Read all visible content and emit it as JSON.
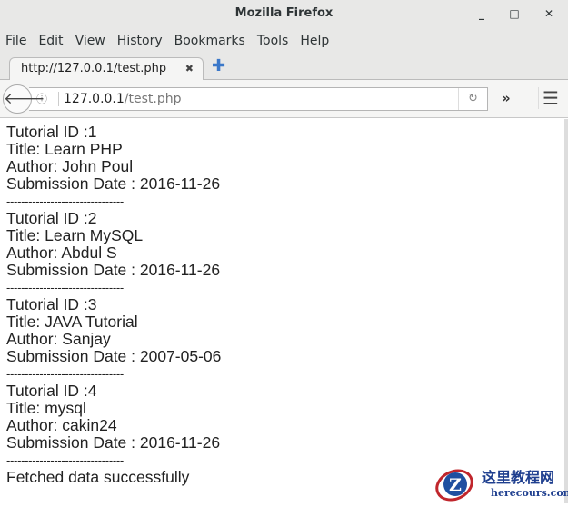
{
  "window": {
    "title": "Mozilla Firefox",
    "minimize": "_",
    "maximize": "□",
    "close": "✕"
  },
  "menu": [
    "File",
    "Edit",
    "View",
    "History",
    "Bookmarks",
    "Tools",
    "Help"
  ],
  "tab": {
    "title": "http://127.0.0.1/test.php",
    "close": "✖",
    "new": "✚"
  },
  "nav": {
    "back": "🡐",
    "info": "ⓘ",
    "url_host": "127.0.0.1",
    "url_path": "/test.php",
    "reload": "↻",
    "overflow": "»",
    "menu": "☰"
  },
  "records": [
    {
      "id": "Tutorial ID :1",
      "title": "Title: Learn PHP",
      "author": "Author: John Poul",
      "date": "Submission Date : 2016-11-26"
    },
    {
      "id": "Tutorial ID :2",
      "title": "Title: Learn MySQL",
      "author": "Author: Abdul S",
      "date": "Submission Date : 2016-11-26"
    },
    {
      "id": "Tutorial ID :3",
      "title": "Title: JAVA Tutorial",
      "author": "Author: Sanjay",
      "date": "Submission Date : 2007-05-06"
    },
    {
      "id": "Tutorial ID :4",
      "title": "Title: mysql",
      "author": "Author: cakin24",
      "date": "Submission Date : 2016-11-26"
    }
  ],
  "separator": "--------------------------------",
  "status": "Fetched data successfully",
  "watermark": {
    "cn": "这里教程网",
    "en": "herecours.com"
  }
}
